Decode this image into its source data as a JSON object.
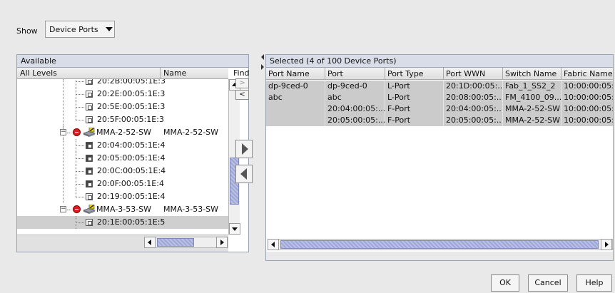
{
  "show": {
    "label": "Show",
    "selected": "Device Ports"
  },
  "available": {
    "title": "Available",
    "columns": [
      "All Levels",
      "Name"
    ],
    "rows": [
      {
        "text": "20:2B:00:05:1E:3",
        "name": "",
        "type": "port",
        "active": false
      },
      {
        "text": "20:2E:00:05:1E:3",
        "name": "",
        "type": "port",
        "active": false
      },
      {
        "text": "20:5E:00:05:1E:3",
        "name": "",
        "type": "port",
        "active": false
      },
      {
        "text": "20:5F:00:05:1E:3",
        "name": "",
        "type": "port",
        "active": false
      },
      {
        "text": "MMA-2-52-SW",
        "name": "MMA-2-52-SW",
        "type": "switch",
        "expander": "−"
      },
      {
        "text": "20:04:00:05:1E:4",
        "name": "",
        "type": "port",
        "active": true
      },
      {
        "text": "20:05:00:05:1E:4",
        "name": "",
        "type": "port",
        "active": true
      },
      {
        "text": "20:0C:00:05:1E:4",
        "name": "",
        "type": "port",
        "active": true
      },
      {
        "text": "20:0F:00:05:1E:4",
        "name": "",
        "type": "port",
        "active": true
      },
      {
        "text": "20:19:00:05:1E:4",
        "name": "",
        "type": "port",
        "active": false
      },
      {
        "text": "MMA-3-53-SW",
        "name": "MMA-3-53-SW",
        "type": "switch",
        "expander": "−"
      },
      {
        "text": "20:1E:00:05:1E:5",
        "name": "",
        "type": "port",
        "active": false
      }
    ]
  },
  "find": {
    "label": "Find",
    "next": ">",
    "prev": "<"
  },
  "selected": {
    "title": "Selected (4 of 100 Device Ports)",
    "columns": [
      "Port Name",
      "Port",
      "Port Type",
      "Port WWN",
      "Switch Name",
      "Fabric Name"
    ],
    "rows": [
      [
        "dp-9ced-0",
        "dp-9ced-0",
        "L-Port",
        "20:1D:00:05:...",
        "Fab_1_SS2_2",
        "10:00:00:05:.."
      ],
      [
        "abc",
        "abc",
        "L-Port",
        "20:08:00:05:...",
        "FM_4100_09...",
        "10:00:00:05:.."
      ],
      [
        "",
        "20:04:00:05:...",
        "F-Port",
        "20:04:00:05:...",
        "MMA-2-52-SW",
        "10:00:00:05:.."
      ],
      [
        "",
        "20:05:00:05:...",
        "F-Port",
        "20:05:00:05:...",
        "MMA-2-52-SW",
        "10:00:00:05:.."
      ]
    ]
  },
  "buttons": {
    "ok": "OK",
    "cancel": "Cancel",
    "help": "Help"
  },
  "colors": {
    "background": "#e9e9e9",
    "panel_title": "#d9dde8",
    "row_selected": "#cbcbcb",
    "scroll_thumb": "#9ea8d6",
    "status_red": "#d72020"
  }
}
